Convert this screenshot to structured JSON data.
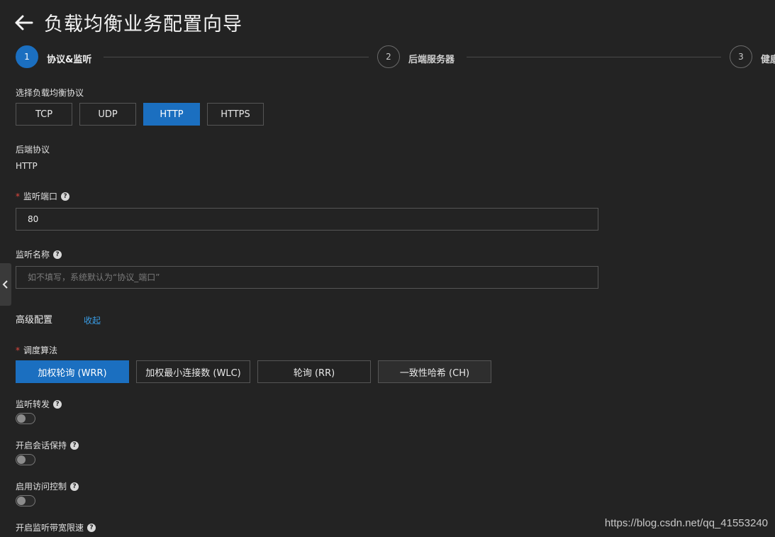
{
  "header": {
    "title": "负载均衡业务配置向导",
    "back_icon": "arrow-left-icon"
  },
  "steps": [
    {
      "number": "1",
      "label": "协议&监听",
      "state": "active"
    },
    {
      "number": "2",
      "label": "后端服务器",
      "state": "idle"
    },
    {
      "number": "3",
      "label": "健康",
      "state": "idle"
    }
  ],
  "protocol": {
    "label": "选择负载均衡协议",
    "options": [
      "TCP",
      "UDP",
      "HTTP",
      "HTTPS"
    ],
    "selected": "HTTP"
  },
  "backend_protocol": {
    "label": "后端协议",
    "value": "HTTP"
  },
  "listen_port": {
    "label": "监听端口",
    "required": true,
    "value": "80"
  },
  "listener_name": {
    "label": "监听名称",
    "value": "",
    "placeholder": "如不填写，系统默认为“协议_端口”"
  },
  "advanced": {
    "title": "高级配置",
    "collapse_label": "收起"
  },
  "scheduling": {
    "label": "调度算法",
    "required": true,
    "options": [
      "加权轮询 (WRR)",
      "加权最小连接数 (WLC)",
      "轮询 (RR)",
      "一致性哈希 (CH)"
    ],
    "selected": "加权轮询 (WRR)"
  },
  "toggles": [
    {
      "label": "监听转发",
      "on": false
    },
    {
      "label": "开启会话保持",
      "on": false
    },
    {
      "label": "启用访问控制",
      "on": false
    },
    {
      "label": "开启监听带宽限速",
      "on": false
    }
  ],
  "watermark": "https://blog.csdn.net/qq_41553240",
  "colors": {
    "accent": "#1b6fc0",
    "link": "#3a9de6",
    "background": "#232323",
    "required": "#e0483e"
  }
}
